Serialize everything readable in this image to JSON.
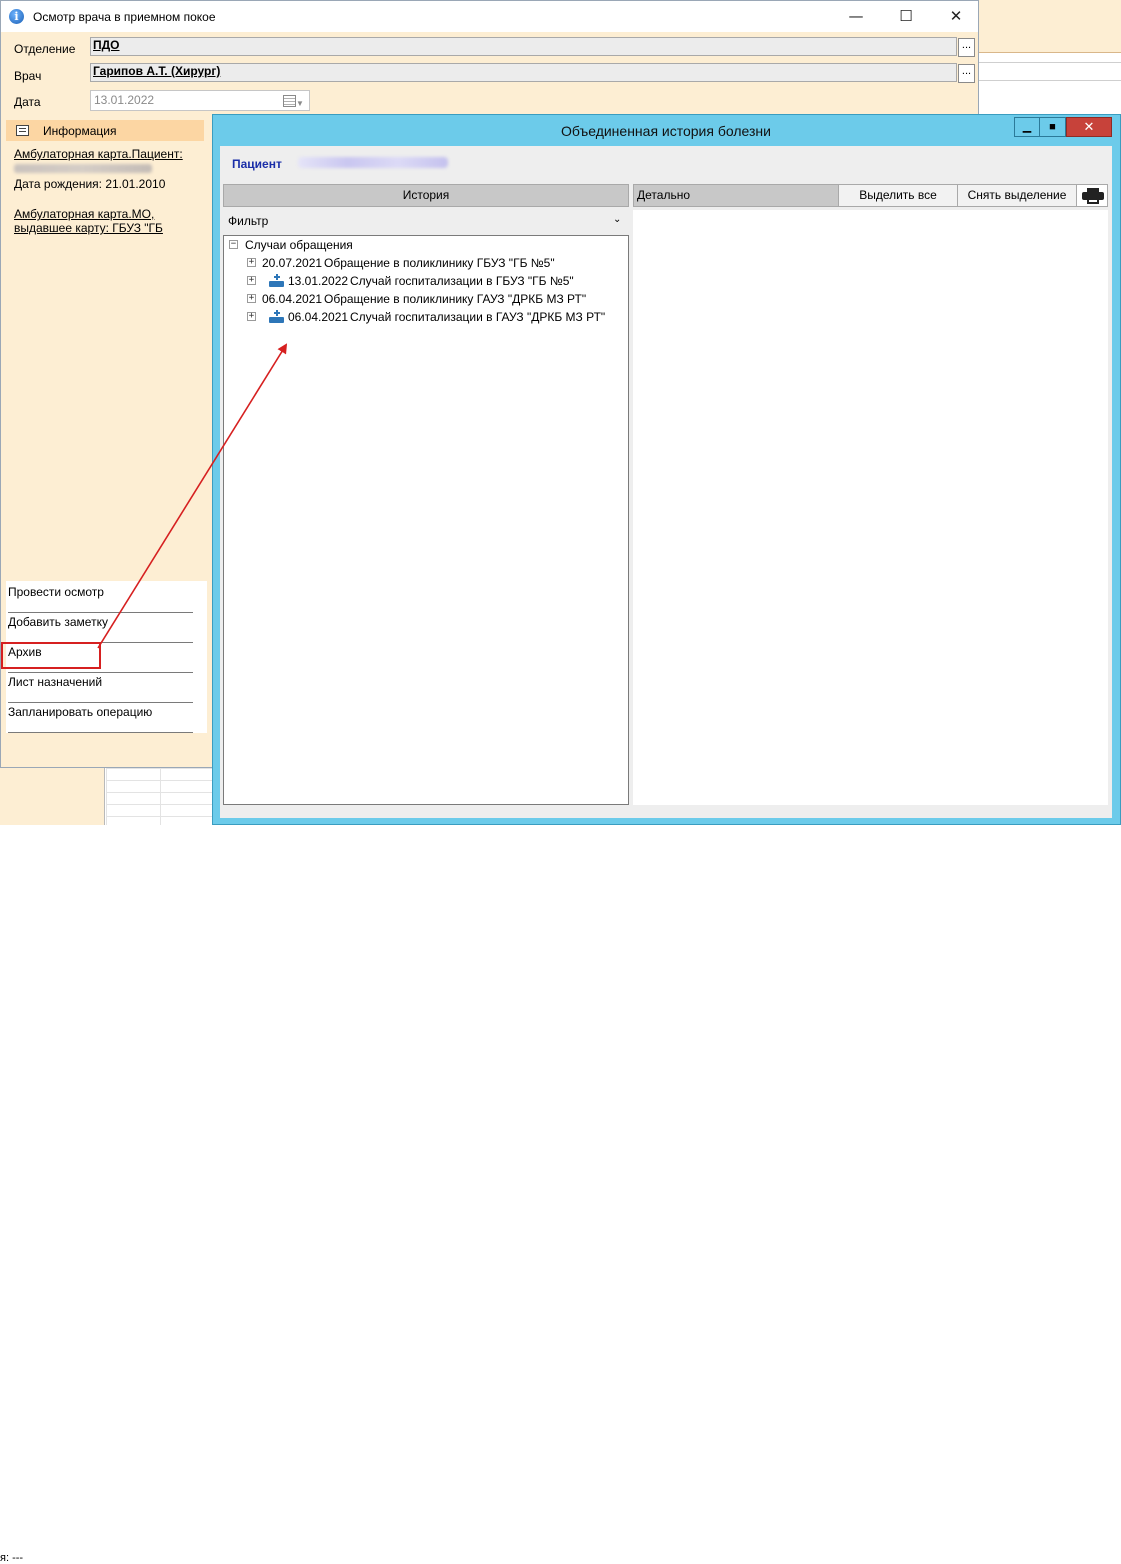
{
  "background": {
    "bottom_left_text": "я: ---"
  },
  "main_window": {
    "title": "Осмотр врача в приемном покое",
    "controls": {
      "minimize": "—",
      "maximize": "☐",
      "close": "✕"
    },
    "form": {
      "department_label": "Отделение",
      "department_value": "ПДО",
      "doctor_label": "Врач",
      "doctor_value": "Гарипов А.Т. (Хирург)",
      "date_label": "Дата",
      "date_value": "13.01.2022",
      "ellipsis": "..."
    },
    "info_panel": {
      "title": "Информация",
      "ambulatory_patient": "Амбулаторная карта.Пациент:",
      "birth_date": "Дата рождения: 21.01.2010",
      "ambulatory_mo_line1": "Амбулаторная карта.МО,",
      "ambulatory_mo_line2": "выдавшее карту: ГБУЗ \"ГБ"
    },
    "actions": [
      {
        "label": "Провести осмотр"
      },
      {
        "label": "Добавить заметку"
      },
      {
        "label": "Архив"
      },
      {
        "label": "Лист назначений"
      },
      {
        "label": "Запланировать операцию"
      }
    ]
  },
  "modal": {
    "title": "Объединенная история болезни",
    "controls": {
      "minimize": "▁",
      "maximize": "■",
      "close": "✕"
    },
    "patient_label": "Пациент",
    "history_header": "История",
    "filter_label": "Фильтр",
    "filter_chevron": "⌄",
    "tree": {
      "root_label": "Случаи обращения",
      "root_expander": "−",
      "child_expander": "+",
      "items": [
        {
          "date": "20.07.2021",
          "text": "Обращение в поликлинику ГБУЗ \"ГБ №5\""
        },
        {
          "date": "13.01.2022",
          "text": "Случай госпитализации в ГБУЗ \"ГБ №5\""
        },
        {
          "date": "06.04.2021",
          "text": "Обращение в поликлинику ГАУЗ \"ДРКБ МЗ РТ\""
        },
        {
          "date": "06.04.2021",
          "text": "Случай госпитализации в ГАУЗ \"ДРКБ МЗ РТ\""
        }
      ]
    },
    "detail_label": "Детально",
    "select_all_label": "Выделить все",
    "clear_selection_label": "Снять выделение"
  },
  "colors": {
    "main_bg": "#fdeed3",
    "modal_frame": "#6ccbea",
    "close_red": "#c7423a",
    "annotation_red": "#d62020",
    "patient_blue": "#1a2ea8"
  }
}
